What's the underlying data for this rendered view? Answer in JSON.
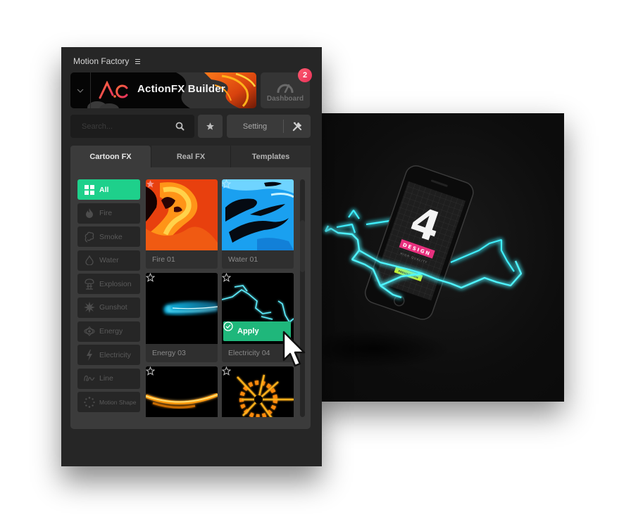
{
  "panel": {
    "title": "Motion Factory",
    "menu_icon": "hamburger-icon",
    "banner": {
      "brand_mark": "A.C",
      "title": "ActionFX Builder",
      "dropdown_icon": "chevron-down-icon"
    },
    "dashboard": {
      "label": "Dashboard",
      "icon": "speedometer-icon",
      "badge_count": "2"
    },
    "search": {
      "placeholder": "Search...",
      "value": "",
      "icon": "search-icon"
    },
    "favorites_icon": "star-icon",
    "setting": {
      "label": "Setting",
      "icon": "tools-icon"
    },
    "tabs": [
      {
        "label": "Cartoon FX",
        "active": true
      },
      {
        "label": "Real FX",
        "active": false
      },
      {
        "label": "Templates",
        "active": false
      }
    ],
    "categories": [
      {
        "label": "All",
        "icon": "grid-icon",
        "active": true
      },
      {
        "label": "Fire",
        "icon": "flame-icon",
        "active": false
      },
      {
        "label": "Smoke",
        "icon": "smoke-icon",
        "active": false
      },
      {
        "label": "Water",
        "icon": "water-drop-icon",
        "active": false
      },
      {
        "label": "Explosion",
        "icon": "mushroom-cloud-icon",
        "active": false
      },
      {
        "label": "Gunshot",
        "icon": "burst-icon",
        "active": false
      },
      {
        "label": "Energy",
        "icon": "atom-icon",
        "active": false
      },
      {
        "label": "Electricity",
        "icon": "lightning-icon",
        "active": false
      },
      {
        "label": "Line",
        "icon": "squiggle-line-icon",
        "active": false
      },
      {
        "label": "Motion Shape",
        "icon": "dotted-circle-icon",
        "active": false
      }
    ],
    "effects": [
      {
        "name": "Fire 01",
        "type": "fire",
        "favorited": true
      },
      {
        "name": "Water 01",
        "type": "water",
        "favorited": false
      },
      {
        "name": "Energy 03",
        "type": "energy",
        "favorited": false
      },
      {
        "name": "Electricity 04",
        "type": "electricity",
        "favorited": false,
        "hovered": true
      },
      {
        "name": "",
        "type": "fire-line",
        "favorited": false
      },
      {
        "name": "",
        "type": "explosion",
        "favorited": false
      }
    ],
    "apply_label": "Apply",
    "accent_color": "#1ed08b",
    "apply_color": "#1fb77b",
    "badge_color": "#f0405f"
  },
  "preview": {
    "screen_number": "4",
    "screen_tag": "DESIGN",
    "screen_subtitle": "HIGH QUALITY",
    "screen_button": "PRESENTATION",
    "glow_color": "#2ee6f0"
  }
}
